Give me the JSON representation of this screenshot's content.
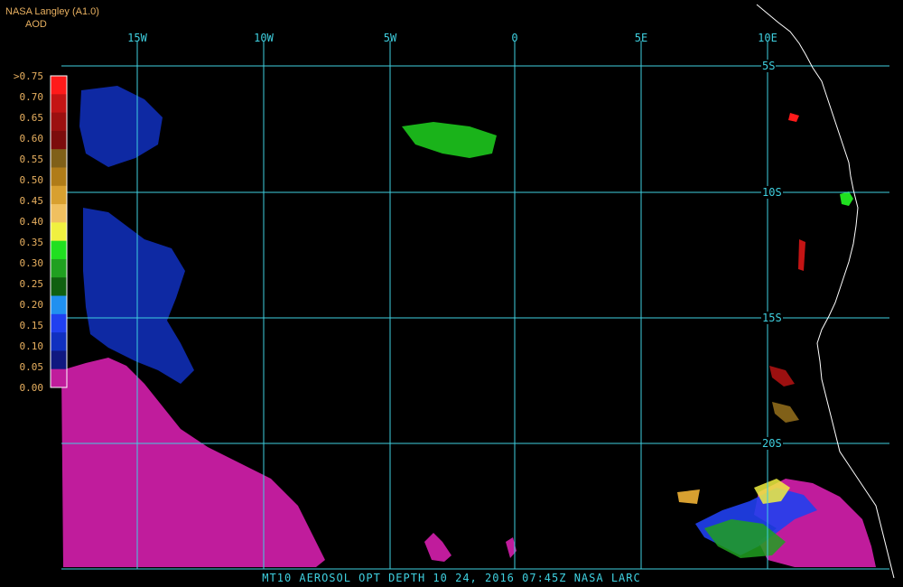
{
  "credit": {
    "source": "NASA Langley (A1.0)",
    "product": "AOD"
  },
  "longitude_labels": [
    "15W",
    "10W",
    "5W",
    "0",
    "5E",
    "10E"
  ],
  "latitude_labels": [
    "5S",
    "10S",
    "15S",
    "20S"
  ],
  "legend": {
    "labels": [
      ">0.75",
      "0.70",
      "0.65",
      "0.60",
      "0.55",
      "0.50",
      "0.45",
      "0.40",
      "0.35",
      "0.30",
      "0.25",
      "0.20",
      "0.15",
      "0.10",
      "0.05",
      "0.00"
    ],
    "colors": [
      "#ff1a1a",
      "#c41414",
      "#9c1010",
      "#7c0c0c",
      "#806018",
      "#b07c18",
      "#d8a030",
      "#f0c060",
      "#f0f040",
      "#20e020",
      "#20a020",
      "#106010",
      "#2090f0",
      "#2040f0",
      "#1030c0",
      "#101880",
      "#c01c9c"
    ]
  },
  "footer": {
    "text": "MT10  AEROSOL OPT DEPTH   10 24, 2016 07:45Z   NASA LARC"
  },
  "colors": {
    "grid": "#3fd0e0",
    "coast": "#ffffff",
    "low_aod": "#c01c9c",
    "label": "#e8b060"
  }
}
